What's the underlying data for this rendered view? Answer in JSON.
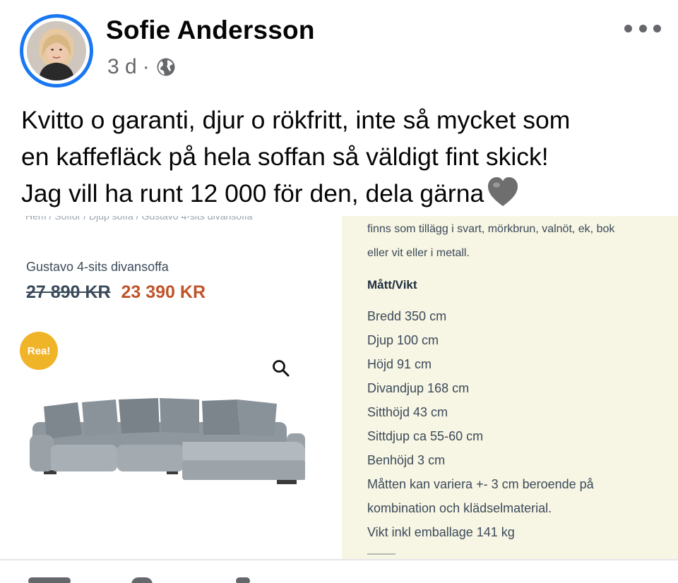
{
  "post": {
    "author": "Sofie Andersson",
    "time": "3 d",
    "separator": "·",
    "audience_icon": "globe-icon",
    "more_icon": "more-dots-icon",
    "text_line1": "Kvitto o garanti, djur o rökfritt, inte så mycket som",
    "text_line2": "en kaffefläck på hela soffan så väldigt fint skick!",
    "text_line3": "Jag vill ha runt 12 000 för den, dela gärna",
    "emoji_icon": "grey-heart-icon"
  },
  "product": {
    "breadcrumb": "Hem / Soffor / Djup soffa / Gustavo 4-sits divansoffa",
    "name": "Gustavo 4-sits divansoffa",
    "old_price": "27 890 KR",
    "new_price": "23 390 KR",
    "badge": "Rea!",
    "zoom_icon": "magnifier-icon"
  },
  "specs": {
    "intro1": "finns som tillägg i svart, mörkbrun, valnöt, ek, bok",
    "intro2": "eller vit eller i metall.",
    "heading": "Mått/Vikt",
    "lines": [
      "Bredd 350 cm",
      "Djup 100 cm",
      "Höjd 91 cm",
      "Divandjup 168 cm",
      "Sitthöjd 43 cm",
      "Sittdjup ca 55-60 cm",
      "Benhöjd 3 cm",
      "Måtten kan variera +- 3 cm beroende på",
      "kombination och klädselmaterial.",
      "Vikt inkl emballage 141 kg"
    ]
  },
  "colors": {
    "accent": "#1877f2",
    "sale": "#c0542a",
    "badge": "#f0b429",
    "spec_bg": "#f7f5e3"
  }
}
